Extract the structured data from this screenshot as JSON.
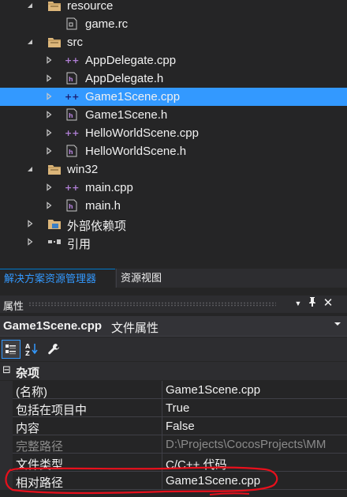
{
  "tree": [
    {
      "label": "resource",
      "type": "filter",
      "expanded": true,
      "depth": 1
    },
    {
      "label": "game.rc",
      "type": "rc",
      "depth": 2
    },
    {
      "label": "src",
      "type": "filter",
      "expanded": true,
      "depth": 1
    },
    {
      "label": "AppDelegate.cpp",
      "type": "cpp",
      "depth": 2
    },
    {
      "label": "AppDelegate.h",
      "type": "h",
      "depth": 2
    },
    {
      "label": "Game1Scene.cpp",
      "type": "cpp",
      "depth": 2,
      "selected": true
    },
    {
      "label": "Game1Scene.h",
      "type": "h",
      "depth": 2
    },
    {
      "label": "HelloWorldScene.cpp",
      "type": "cpp",
      "depth": 2
    },
    {
      "label": "HelloWorldScene.h",
      "type": "h",
      "depth": 2
    },
    {
      "label": "win32",
      "type": "filter",
      "expanded": true,
      "depth": 1
    },
    {
      "label": "main.cpp",
      "type": "cpp",
      "depth": 2
    },
    {
      "label": "main.h",
      "type": "h",
      "depth": 2
    },
    {
      "label": "外部依赖项",
      "type": "extdeps",
      "depth": 1
    },
    {
      "label": "引用",
      "type": "refs",
      "depth": 1
    }
  ],
  "tabs": {
    "solution_explorer": "解决方案资源管理器",
    "resource_view": "资源视图"
  },
  "properties": {
    "title": "属性",
    "object_name": "Game1Scene.cpp",
    "object_type": "文件属性",
    "category": "杂项",
    "rows": [
      {
        "name": "(名称)",
        "value": "Game1Scene.cpp",
        "dim": false
      },
      {
        "name": "包括在项目中",
        "value": "True",
        "dim": false
      },
      {
        "name": "内容",
        "value": "False",
        "dim": false
      },
      {
        "name": "完整路径",
        "value": "D:\\Projects\\CocosProjects\\MM",
        "dim": true
      },
      {
        "name": "文件类型",
        "value": "C/C++ 代码",
        "dim": false
      },
      {
        "name": "相对路径",
        "value": "Game1Scene.cpp",
        "dim": false
      }
    ]
  },
  "colors": {
    "accent": "#3399ff",
    "annotation": "#e8101c"
  }
}
